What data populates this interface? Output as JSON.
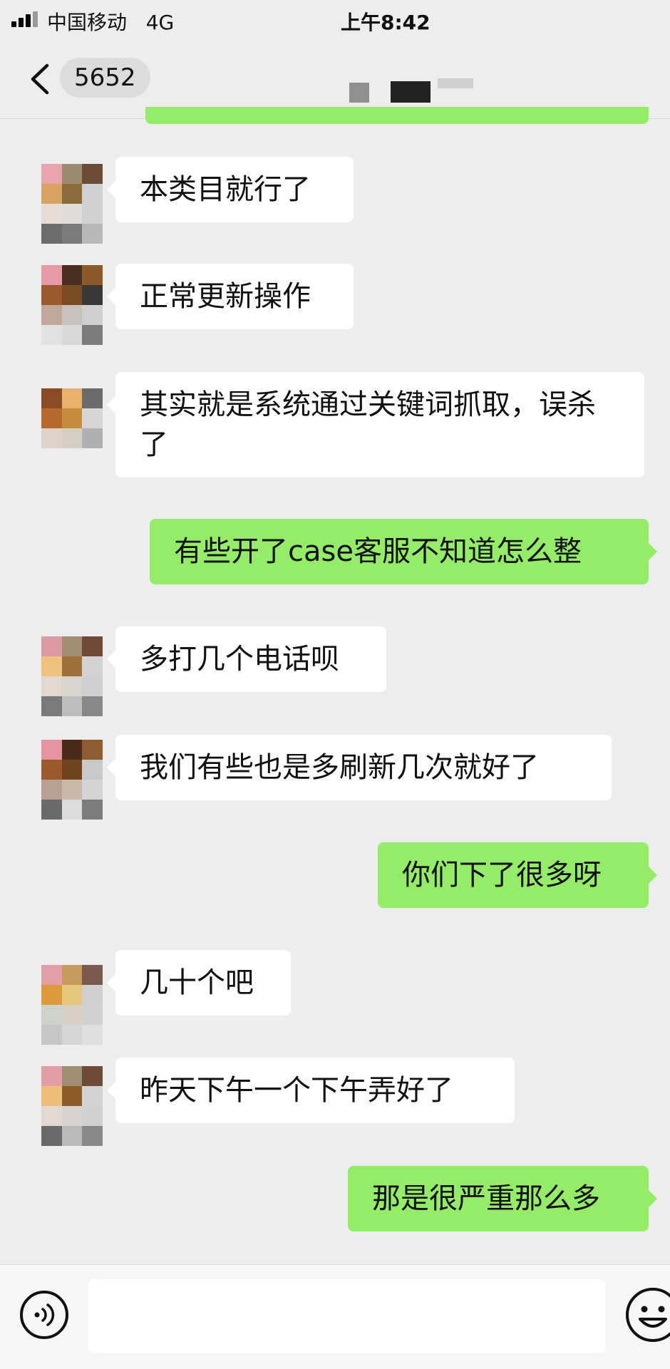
{
  "status_bar": {
    "carrier": "中国移动",
    "network": "4G",
    "time": "上午8:42"
  },
  "header": {
    "back_icon": "chevron-left-icon",
    "title": "5652"
  },
  "messages": [
    {
      "direction": "in",
      "text": "本类目就行了"
    },
    {
      "direction": "in",
      "text": "正常更新操作"
    },
    {
      "direction": "in",
      "text": "其实就是系统通过关键词抓取，误杀了"
    },
    {
      "direction": "out",
      "text": "有些开了case客服不知道怎么整"
    },
    {
      "direction": "in",
      "text": "多打几个电话呗"
    },
    {
      "direction": "in",
      "text": "我们有些也是多刷新几次就好了"
    },
    {
      "direction": "out",
      "text": "你们下了很多呀"
    },
    {
      "direction": "in",
      "text": "几十个吧"
    },
    {
      "direction": "in",
      "text": "昨天下午一个下午弄好了"
    },
    {
      "direction": "out",
      "text": "那是很严重那么多"
    }
  ],
  "input_bar": {
    "voice_icon": "voice-icon",
    "input_value": "",
    "emoji_icon": "emoji-icon"
  },
  "colors": {
    "background": "#ededed",
    "outgoing_bubble": "#95ec69",
    "incoming_bubble": "#ffffff"
  }
}
